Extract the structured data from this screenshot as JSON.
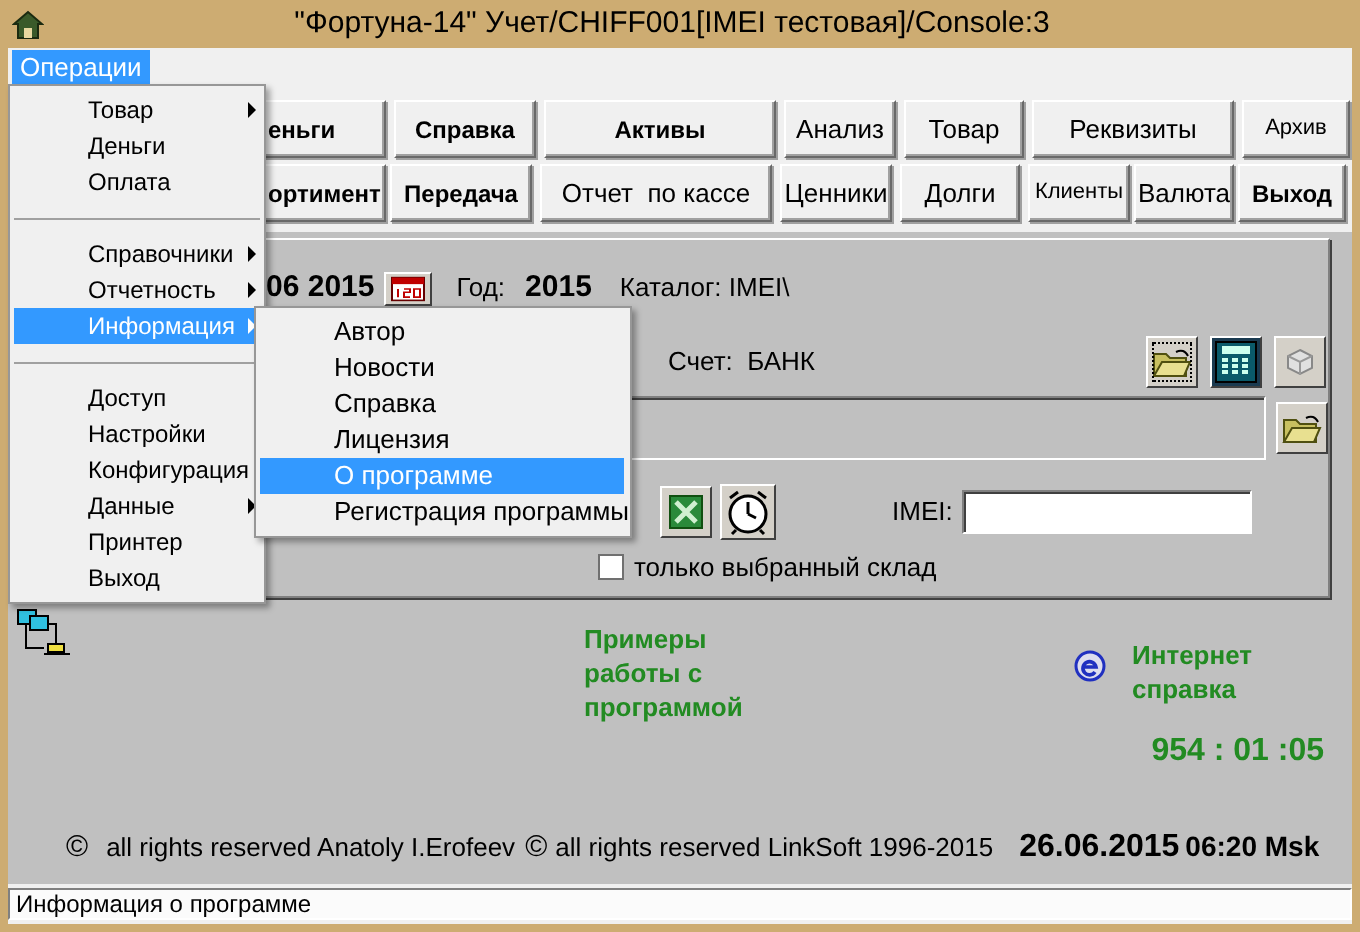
{
  "window": {
    "title": "\"Фортуна-14\" Учет/CHIFF001[IMEI тестовая]/Console:3"
  },
  "menu_bar": [
    {
      "label": "Операции",
      "selected": true
    }
  ],
  "toolbar": [
    [
      {
        "label": "еньги",
        "bold": true
      },
      {
        "label": "Справка",
        "bold": true
      },
      {
        "label": "Активы",
        "bold": true
      },
      {
        "label": "Анализ",
        "bold": false
      },
      {
        "label": "Товар",
        "bold": false
      },
      {
        "label": "Реквизиты",
        "bold": false
      },
      {
        "label": "Архив",
        "bold": false,
        "compact": true
      }
    ],
    [
      {
        "label": "ортимент",
        "bold": true
      },
      {
        "label": "Передача",
        "bold": true
      },
      {
        "label": "Отчет  по кассе",
        "bold": false
      },
      {
        "label": "Ценники",
        "bold": false
      },
      {
        "label": "Долги",
        "bold": false
      },
      {
        "label": "Клиенты",
        "bold": false,
        "compact": true
      },
      {
        "label": "Валюта",
        "bold": false
      },
      {
        "label": "Выход",
        "bold": true
      }
    ]
  ],
  "panel": {
    "date": "06 2015",
    "year_label": "Год:",
    "year": "2015",
    "catalog": "Каталог: IMEI\\",
    "account": "Счет:  БАНК",
    "imei_label": "IMEI:",
    "only_selected": {
      "label": "только выбранный склад",
      "checked": false
    }
  },
  "examples_link": "Примеры работы с программой",
  "internet_help_link": "Интернет справка",
  "timer": "954 : 01 :05",
  "copyrights": [
    {
      "symbol": "©",
      "text": "all rights reserved Anatoly I.Erofeev"
    },
    {
      "symbol": "©",
      "text": "all rights reserved LinkSoft 1996-2015"
    }
  ],
  "date": "26.06.2015",
  "time": "06:20 Msk",
  "status_bar": "Информация о программе",
  "operations_menu": [
    {
      "kind": "item",
      "label": "Товар",
      "submenu": true,
      "selected": false
    },
    {
      "kind": "item",
      "label": "Деньги",
      "submenu": false,
      "selected": false
    },
    {
      "kind": "item",
      "label": "Оплата",
      "submenu": false,
      "selected": false
    },
    {
      "kind": "separator"
    },
    {
      "kind": "item",
      "label": "Справочники",
      "submenu": true,
      "selected": false
    },
    {
      "kind": "item",
      "label": "Отчетность",
      "submenu": true,
      "selected": false
    },
    {
      "kind": "item",
      "label": "Информация",
      "submenu": true,
      "selected": true
    },
    {
      "kind": "separator"
    },
    {
      "kind": "item",
      "label": "Доступ",
      "submenu": false,
      "selected": false
    },
    {
      "kind": "item",
      "label": "Настройки",
      "submenu": false,
      "selected": false
    },
    {
      "kind": "item",
      "label": "Конфигурация",
      "submenu": false,
      "selected": false
    },
    {
      "kind": "item",
      "label": "Данные",
      "submenu": true,
      "selected": false
    },
    {
      "kind": "item",
      "label": "Принтер",
      "submenu": false,
      "selected": false
    },
    {
      "kind": "item",
      "label": "Выход",
      "submenu": false,
      "selected": false
    }
  ],
  "information_submenu": [
    {
      "label": "Автор",
      "selected": false
    },
    {
      "label": "Новости",
      "selected": false
    },
    {
      "label": "Справка",
      "selected": false
    },
    {
      "label": "Лицензия",
      "selected": false
    },
    {
      "label": "О программе",
      "selected": true
    },
    {
      "label": "Регистрация программы",
      "selected": false
    }
  ]
}
